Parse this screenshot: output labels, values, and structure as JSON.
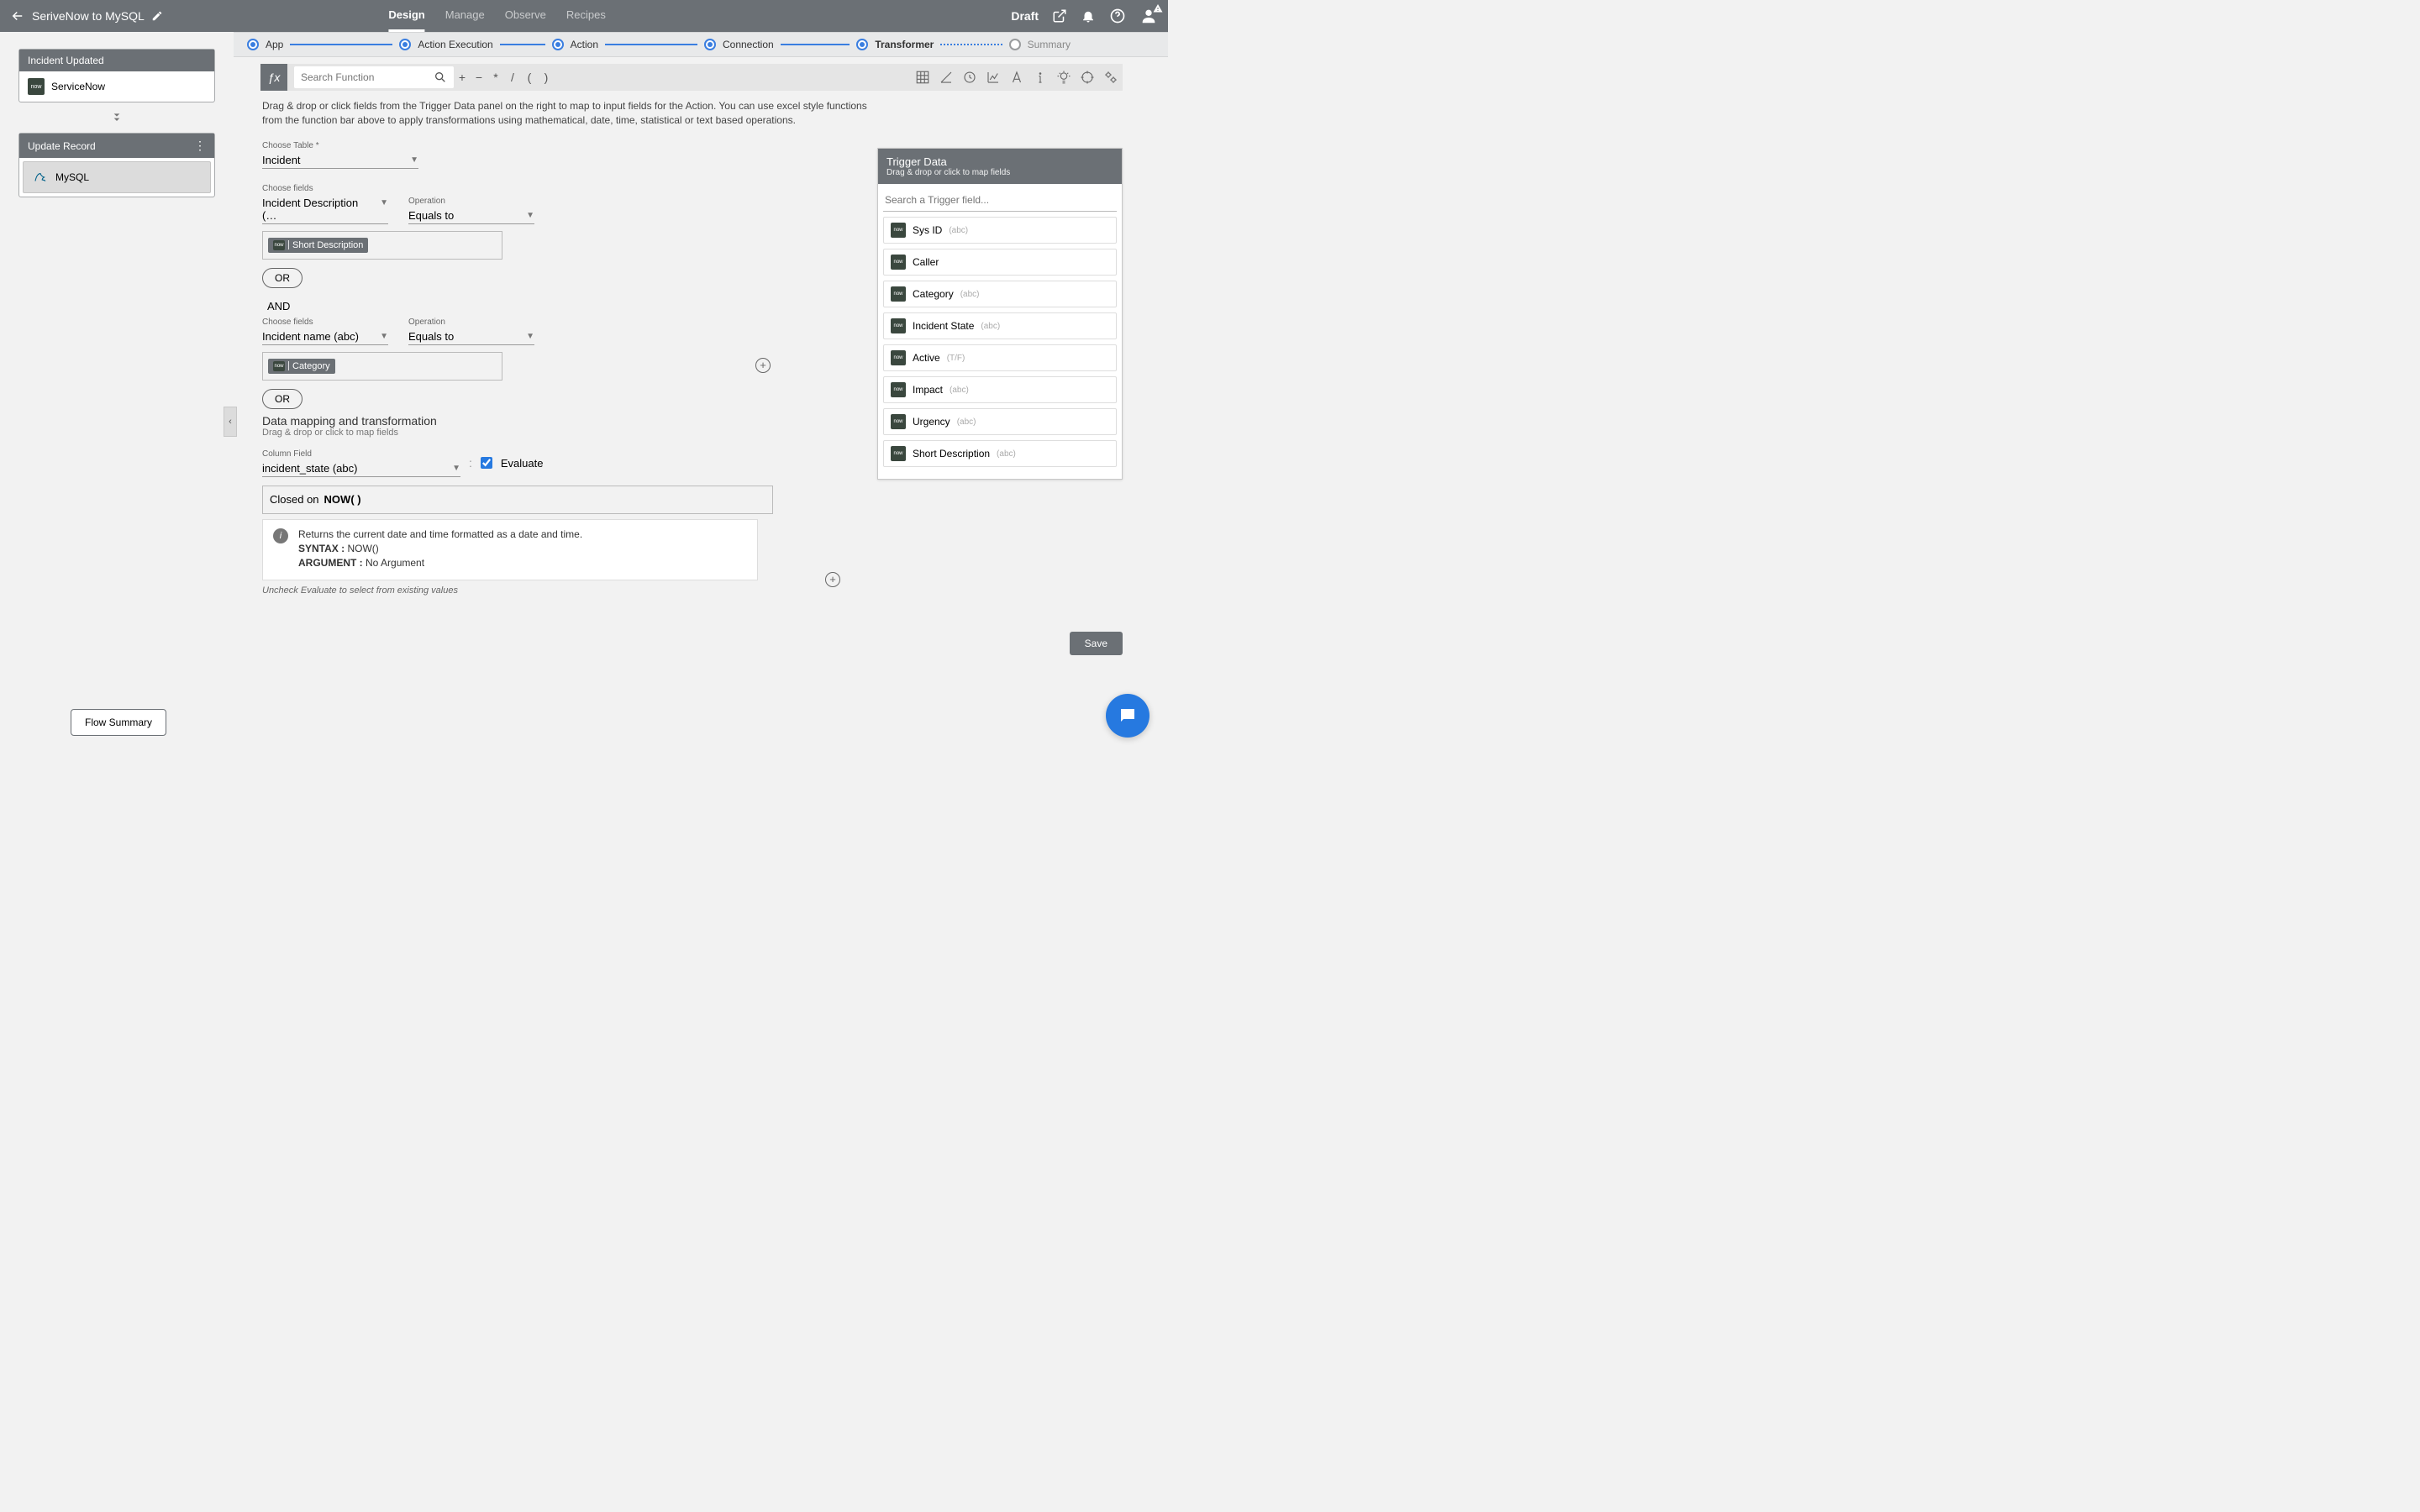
{
  "header": {
    "title": "SeriveNow to MySQL",
    "tabs": [
      "Design",
      "Manage",
      "Observe",
      "Recipes"
    ],
    "activeTab": 0,
    "status": "Draft"
  },
  "steps": [
    {
      "label": "App",
      "state": "filled"
    },
    {
      "label": "Action Execution",
      "state": "filled"
    },
    {
      "label": "Action",
      "state": "filled"
    },
    {
      "label": "Connection",
      "state": "filled"
    },
    {
      "label": "Transformer",
      "state": "filled",
      "dotted": true
    },
    {
      "label": "Summary",
      "state": "inactive"
    }
  ],
  "sidebar": {
    "triggerCard": {
      "header": "Incident Updated",
      "app": "ServiceNow"
    },
    "actionCard": {
      "header": "Update Record",
      "app": "MySQL"
    },
    "flowSummary": "Flow Summary"
  },
  "functionBar": {
    "searchPlaceholder": "Search Function",
    "ops": [
      "+",
      "−",
      "*",
      "/",
      "(",
      ")"
    ]
  },
  "instructions": "Drag & drop or click fields from the Trigger Data panel on the right to map to input fields for the Action. You can use excel style functions from the function bar above to apply transformations using mathematical, date, time, statistical or text based operations.",
  "form": {
    "tableLabel": "Choose Table *",
    "tableValue": "Incident",
    "filter1": {
      "fieldsLabel": "Choose fields",
      "fieldValue": "Incident Description (…",
      "opLabel": "Operation",
      "opValue": "Equals to",
      "chip": "Short Description"
    },
    "orLabel": "OR",
    "andLabel": "AND",
    "filter2": {
      "fieldsLabel": "Choose fields",
      "fieldValue": "Incident name (abc)",
      "opLabel": "Operation",
      "opValue": "Equals to",
      "chip": "Category"
    },
    "mappingTitle": "Data mapping and transformation",
    "mappingSub": "Drag & drop or click to map fields",
    "columnLabel": "Column Field",
    "columnValue": "incident_state (abc)",
    "evaluateLabel": "Evaluate",
    "exprPrefix": "Closed on",
    "exprFn": "NOW( )",
    "hint": {
      "line1": "Returns the current date and time formatted as a date and time.",
      "syntaxLabel": "SYNTAX :",
      "syntaxVal": "NOW()",
      "argLabel": "ARGUMENT :",
      "argVal": "No Argument"
    },
    "uncheckNote": "Uncheck Evaluate to select from existing values",
    "saveLabel": "Save"
  },
  "triggerPanel": {
    "title": "Trigger Data",
    "sub": "Drag & drop or click to map fields",
    "searchPlaceholder": "Search a Trigger field...",
    "fields": [
      {
        "name": "Sys ID",
        "type": "(abc)"
      },
      {
        "name": "Caller",
        "type": ""
      },
      {
        "name": "Category",
        "type": "(abc)"
      },
      {
        "name": "Incident State",
        "type": "(abc)"
      },
      {
        "name": "Active",
        "type": "(T/F)"
      },
      {
        "name": "Impact",
        "type": "(abc)"
      },
      {
        "name": "Urgency",
        "type": "(abc)"
      },
      {
        "name": "Short Description",
        "type": "(abc)"
      }
    ]
  }
}
